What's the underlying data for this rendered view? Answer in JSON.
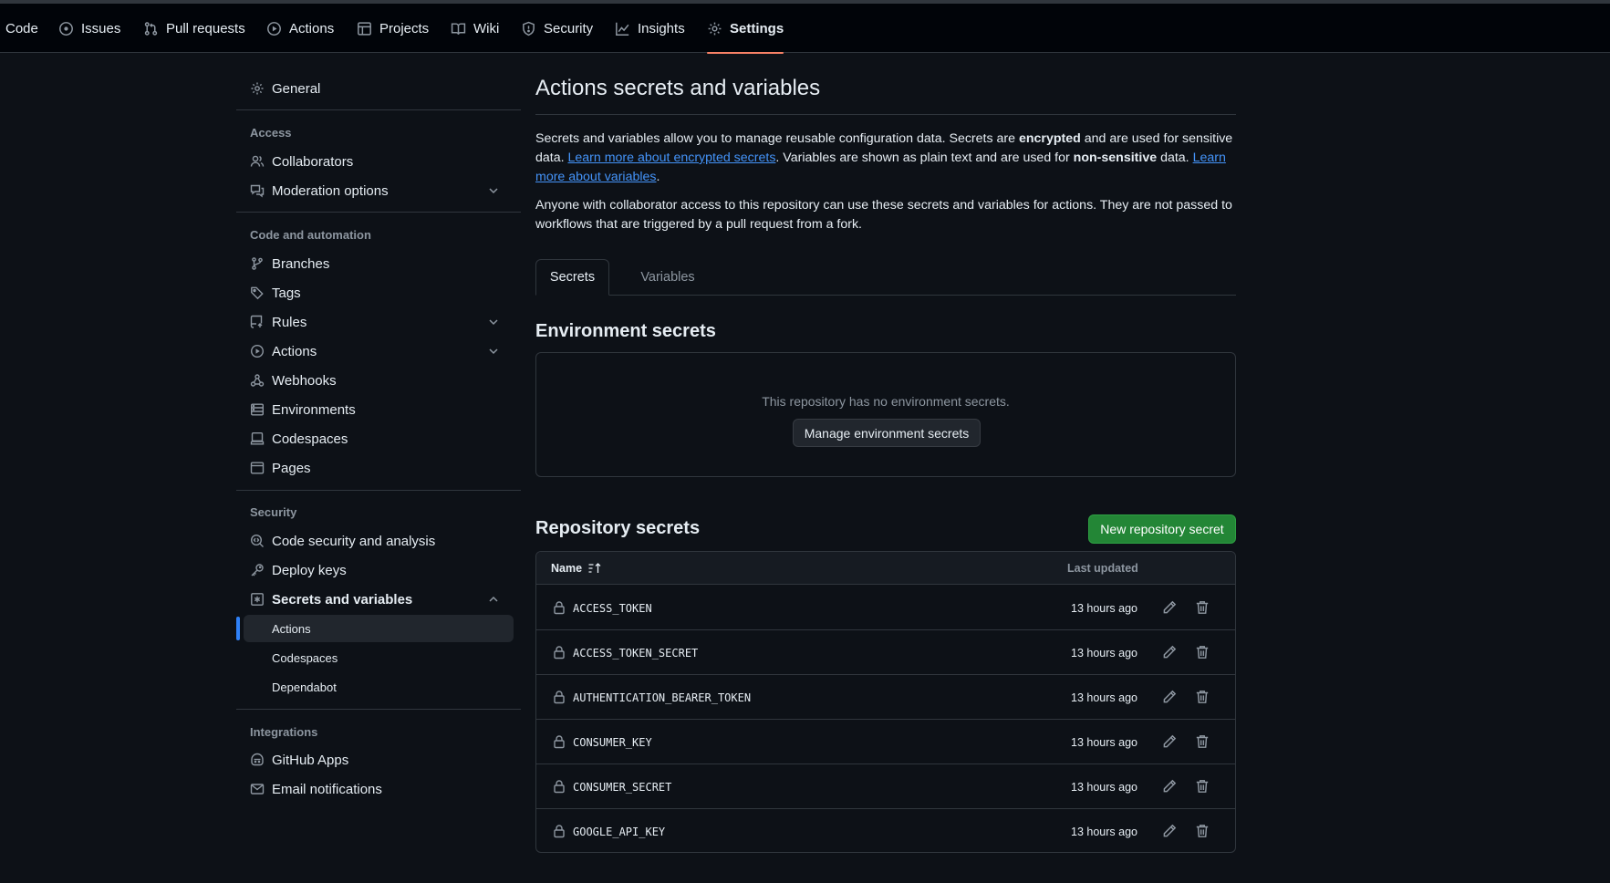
{
  "repo_nav": {
    "tabs": [
      {
        "label": "Code",
        "icon": "code-icon"
      },
      {
        "label": "Issues",
        "icon": "issue-icon"
      },
      {
        "label": "Pull requests",
        "icon": "pull-request-icon"
      },
      {
        "label": "Actions",
        "icon": "play-icon"
      },
      {
        "label": "Projects",
        "icon": "table-icon"
      },
      {
        "label": "Wiki",
        "icon": "book-icon"
      },
      {
        "label": "Security",
        "icon": "shield-icon"
      },
      {
        "label": "Insights",
        "icon": "graph-icon"
      },
      {
        "label": "Settings",
        "icon": "gear-icon",
        "selected": true
      }
    ]
  },
  "sidebar": {
    "general": "General",
    "access_heading": "Access",
    "collaborators": "Collaborators",
    "moderation": "Moderation options",
    "code_heading": "Code and automation",
    "branches": "Branches",
    "tags": "Tags",
    "rules": "Rules",
    "actions": "Actions",
    "webhooks": "Webhooks",
    "environments": "Environments",
    "codespaces": "Codespaces",
    "pages": "Pages",
    "security_heading": "Security",
    "code_security": "Code security and analysis",
    "deploy_keys": "Deploy keys",
    "secrets_vars": "Secrets and variables",
    "sub_actions": "Actions",
    "sub_codespaces": "Codespaces",
    "sub_dependabot": "Dependabot",
    "integrations_heading": "Integrations",
    "github_apps": "GitHub Apps",
    "email_notifications": "Email notifications"
  },
  "main": {
    "title": "Actions secrets and variables",
    "desc1": {
      "t1": "Secrets and variables allow you to manage reusable configuration data. Secrets are ",
      "b1": "encrypted",
      "t2": " and are used for sensitive data. ",
      "link1": "Learn more about encrypted secrets",
      "t3": ". Variables are shown as plain text and are used for ",
      "b2": "non-sensitive",
      "t4": " data. ",
      "link2": "Learn more about variables",
      "t5": "."
    },
    "desc2": "Anyone with collaborator access to this repository can use these secrets and variables for actions. They are not passed to workflows that are triggered by a pull request from a fork.",
    "tabs": {
      "secrets": "Secrets",
      "variables": "Variables"
    },
    "env_heading": "Environment secrets",
    "env_empty": "This repository has no environment secrets.",
    "env_button": "Manage environment secrets",
    "repo_heading": "Repository secrets",
    "new_secret_button": "New repository secret",
    "table": {
      "col_name": "Name",
      "col_updated": "Last updated",
      "rows": [
        {
          "name": "ACCESS_TOKEN",
          "updated": "13 hours ago"
        },
        {
          "name": "ACCESS_TOKEN_SECRET",
          "updated": "13 hours ago"
        },
        {
          "name": "AUTHENTICATION_BEARER_TOKEN",
          "updated": "13 hours ago"
        },
        {
          "name": "CONSUMER_KEY",
          "updated": "13 hours ago"
        },
        {
          "name": "CONSUMER_SECRET",
          "updated": "13 hours ago"
        },
        {
          "name": "GOOGLE_API_KEY",
          "updated": "13 hours ago"
        }
      ]
    }
  },
  "colors": {
    "background": "#0d1117",
    "border": "#30363d",
    "accent_link": "#4493f8",
    "primary_button": "#238636",
    "selected_tab_underline": "#f78166",
    "active_sidebar_bar": "#2f81f7"
  }
}
